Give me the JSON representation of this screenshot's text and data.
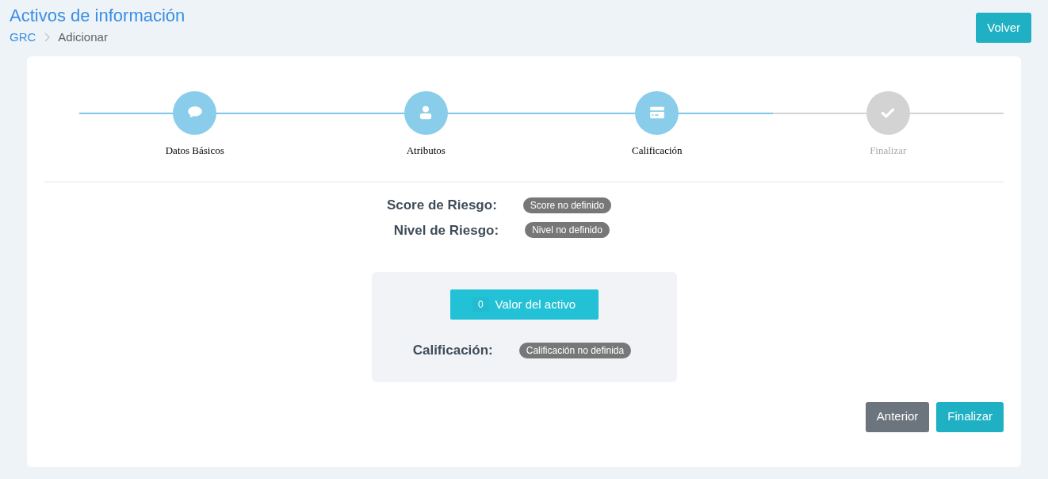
{
  "header": {
    "title": "Activos de información",
    "breadcrumb": [
      "GRC",
      "Adicionar"
    ],
    "back_button": "Volver"
  },
  "steps": [
    {
      "label": "Datos Básicos",
      "done": true
    },
    {
      "label": "Atributos",
      "done": true
    },
    {
      "label": "Calificación",
      "done": true
    },
    {
      "label": "Finalizar",
      "done": false
    }
  ],
  "risk": [
    {
      "label": "Score de Riesgo:",
      "badge": "Score no definido"
    },
    {
      "label": "Nivel de Riesgo:",
      "badge": "Nivel no definido"
    }
  ],
  "asset_panel": {
    "value_count": "0",
    "value_button": "Valor del activo",
    "label": "Calificación:",
    "badge": "Calificación no definida"
  },
  "buttons": [
    {
      "label": "Anterior",
      "kind": "secondary"
    },
    {
      "label": "Finalizar",
      "kind": "primary"
    }
  ]
}
